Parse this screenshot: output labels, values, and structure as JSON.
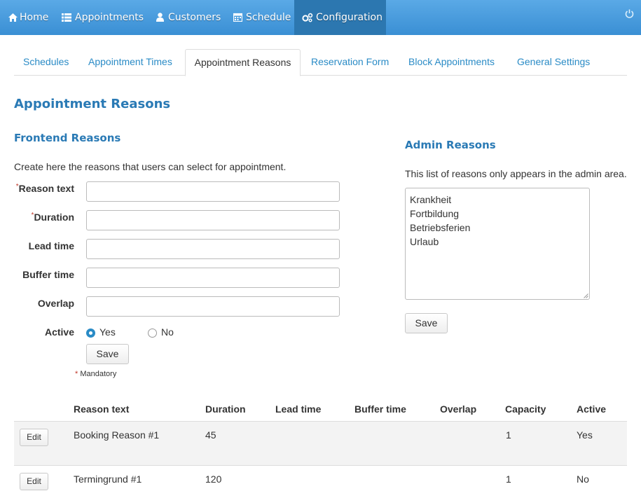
{
  "topnav": {
    "items": [
      {
        "label": "Home",
        "icon": "home-icon"
      },
      {
        "label": "Appointments",
        "icon": "list-icon"
      },
      {
        "label": "Customers",
        "icon": "user-icon"
      },
      {
        "label": "Schedule",
        "icon": "calendar-icon"
      },
      {
        "label": "Configuration",
        "icon": "gears-icon"
      }
    ],
    "active": "Configuration",
    "power_icon": "power-icon"
  },
  "tabs": [
    "Schedules",
    "Appointment Times",
    "Appointment Reasons",
    "Reservation Form",
    "Block Appointments",
    "General Settings"
  ],
  "active_tab": "Appointment Reasons",
  "page_title": "Appointment Reasons",
  "frontend": {
    "title": "Frontend Reasons",
    "description": "Create here the reasons that users can select for appointment.",
    "fields": {
      "reason_text": "Reason text",
      "duration": "Duration",
      "lead_time": "Lead time",
      "buffer_time": "Buffer time",
      "overlap": "Overlap",
      "active": "Active"
    },
    "required_mark": "*",
    "active_options": {
      "yes": "Yes",
      "no": "No",
      "selected": "Yes"
    },
    "save": "Save",
    "mandatory_note": "Mandatory"
  },
  "admin": {
    "title": "Admin Reasons",
    "description": "This list of reasons only appears in the admin area.",
    "reasons": [
      "Krankheit",
      "Fortbildung",
      "Betriebsferien",
      "Urlaub"
    ],
    "save": "Save"
  },
  "table": {
    "headers": [
      "Reason text",
      "Duration",
      "Lead time",
      "Buffer time",
      "Overlap",
      "Capacity",
      "Active"
    ],
    "edit_label": "Edit",
    "rows": [
      {
        "reason": "Booking Reason #1",
        "duration": "45",
        "lead": "",
        "buffer": "",
        "overlap": "",
        "capacity": "1",
        "active": "Yes"
      },
      {
        "reason": "Termingrund #1",
        "duration": "120",
        "lead": "",
        "buffer": "",
        "overlap": "",
        "capacity": "1",
        "active": "No"
      }
    ]
  },
  "colors": {
    "nav_bg": "#4a9ede",
    "nav_active": "#2c77b0",
    "link": "#2a8bc6",
    "heading": "#2a7ab5",
    "required": "#c0392b"
  }
}
